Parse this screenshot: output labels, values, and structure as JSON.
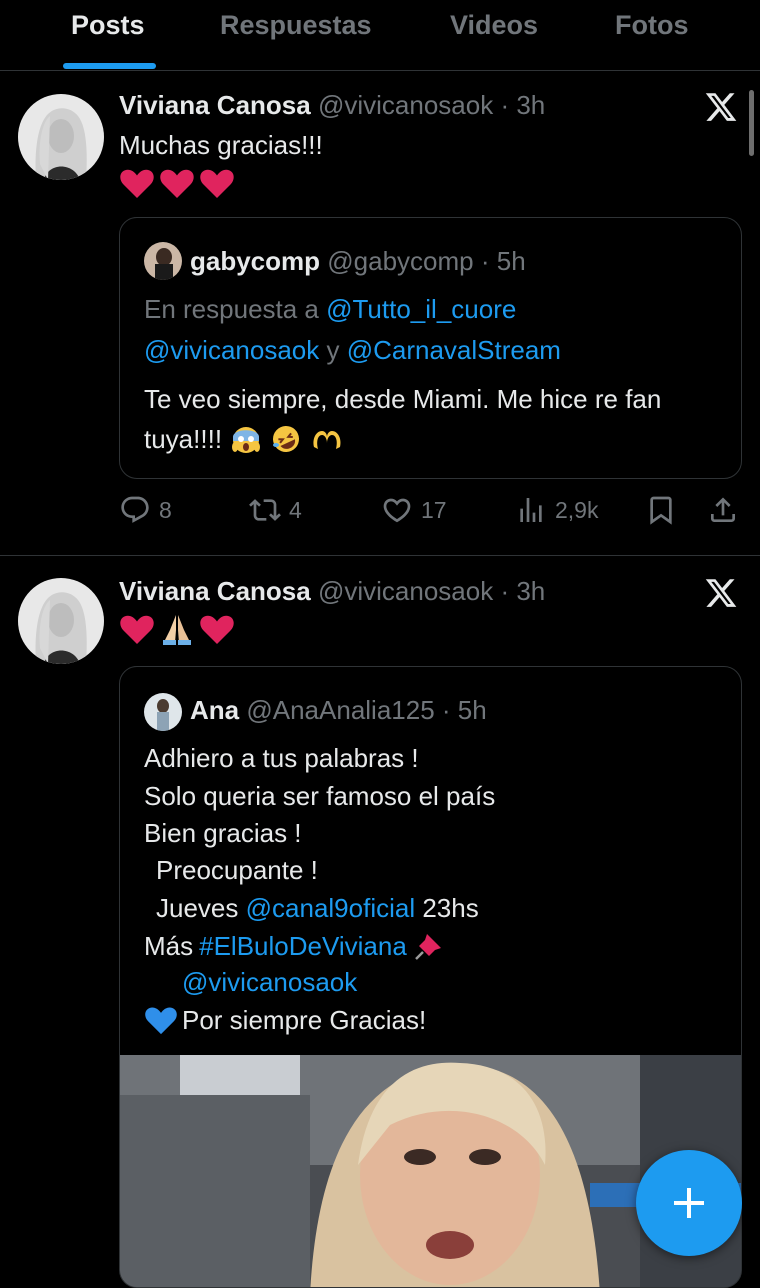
{
  "tabs": [
    {
      "label": "Posts",
      "active": true
    },
    {
      "label": "Respuestas",
      "active": false
    },
    {
      "label": "Videos",
      "active": false
    },
    {
      "label": "Fotos",
      "active": false
    }
  ],
  "posts": [
    {
      "author_name": "Viviana Canosa",
      "author_handle": "@vivicanosaok",
      "time": "3h",
      "text": "Muchas gracias!!!",
      "emoji_line": [
        "heart",
        "heart",
        "heart"
      ],
      "quote": {
        "author_name": "gabycomp",
        "author_handle": "@gabycomp",
        "time": "5h",
        "reply_prefix": "En respuesta a",
        "reply_to_1": "@Tutto_il_cuore",
        "reply_to_2": "@vivicanosaok",
        "reply_conj": "y",
        "reply_to_3": "@CarnavalStream",
        "text_1": "Te veo siempre, desde Miami. Me hice re fan",
        "text_2": "tuya!!!!"
      },
      "actions": {
        "replies": "8",
        "reposts": "4",
        "likes": "17",
        "views": "2,9k"
      }
    },
    {
      "author_name": "Viviana Canosa",
      "author_handle": "@vivicanosaok",
      "time": "3h",
      "emoji_line": [
        "heart",
        "pray",
        "heart"
      ],
      "quote": {
        "author_name": "Ana",
        "author_handle": "@AnaAnalia125",
        "time": "5h",
        "line_1": "Adhiero a tus palabras !",
        "line_2": "Solo queria ser famoso el país",
        "line_3": "Bien gracias !",
        "line_4": "Preocupante !",
        "line_5_a": "Jueves",
        "line_5_link": "@canal9oficial",
        "line_5_b": "23hs",
        "line_6_a": "Más",
        "line_6_link": "#ElBuloDeViviana",
        "line_7_link": "@vivicanosaok",
        "line_8": "Por siempre Gracias!"
      }
    }
  ],
  "colors": {
    "accent": "#1d9bf0",
    "heart": "#e0245e",
    "muted": "#71767b",
    "background": "#000000"
  },
  "icons": [
    "x-logo-icon",
    "reply-icon",
    "repost-icon",
    "like-icon",
    "views-icon",
    "bookmark-icon",
    "share-icon",
    "compose-plus-icon"
  ]
}
